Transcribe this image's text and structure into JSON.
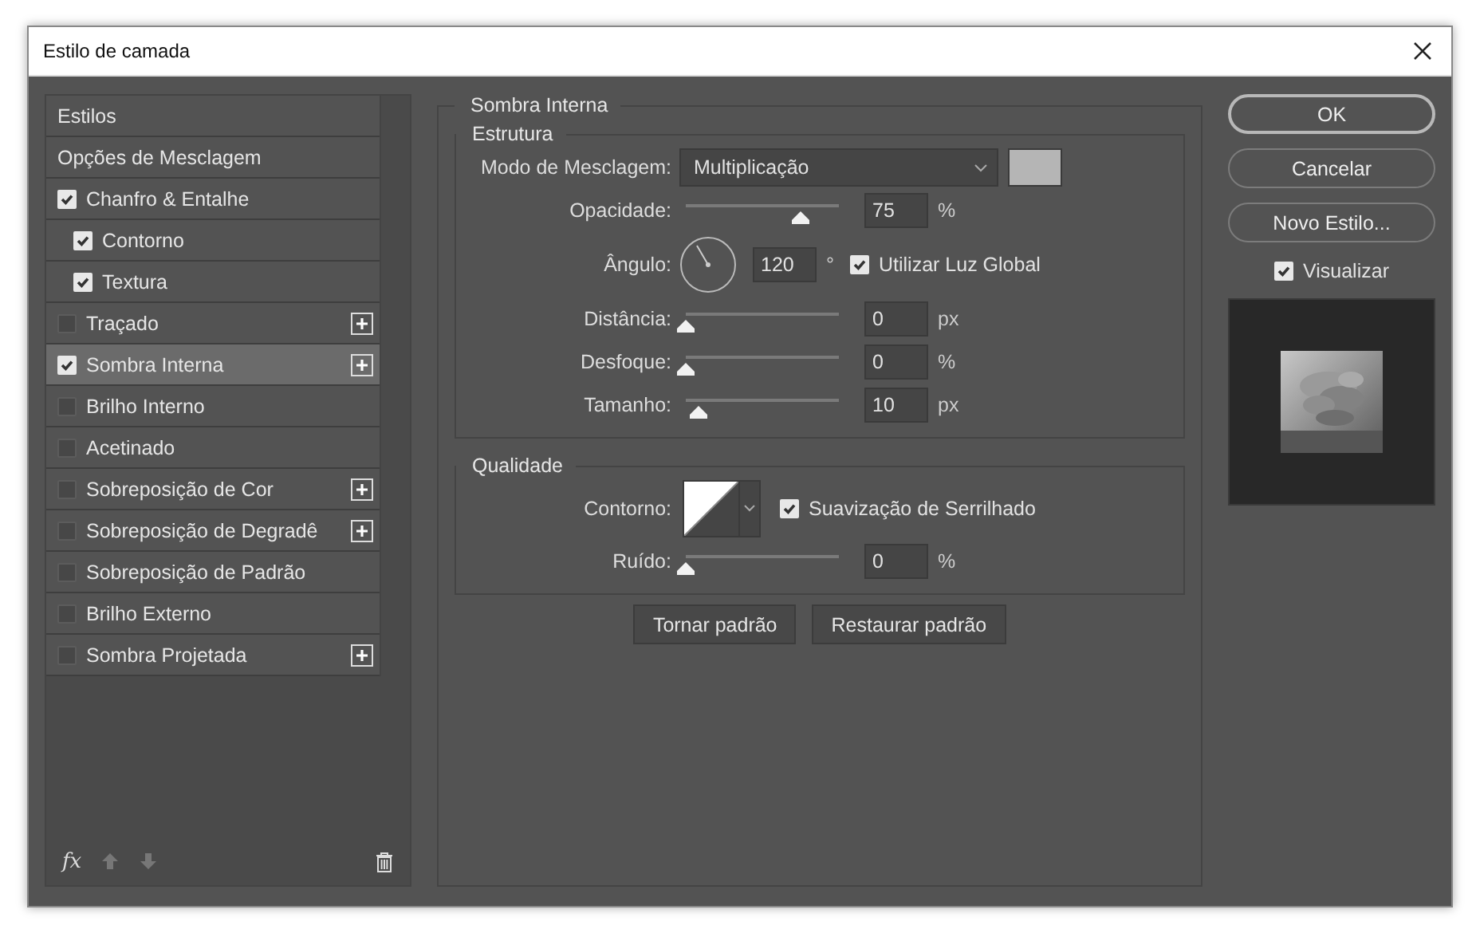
{
  "window": {
    "title": "Estilo de camada"
  },
  "styles": {
    "items": [
      {
        "label": "Estilos",
        "kind": "header",
        "selected": false
      },
      {
        "label": "Opções de Mesclagem",
        "kind": "header",
        "selected": false
      },
      {
        "label": "Chanfro & Entalhe",
        "kind": "check",
        "checked": true,
        "addable": false,
        "selected": false,
        "children": [
          {
            "label": "Contorno",
            "kind": "check",
            "checked": true,
            "addable": false,
            "selected": false
          },
          {
            "label": "Textura",
            "kind": "check",
            "checked": true,
            "addable": false,
            "selected": false
          }
        ]
      },
      {
        "label": "Traçado",
        "kind": "check",
        "checked": false,
        "addable": true,
        "selected": false
      },
      {
        "label": "Sombra Interna",
        "kind": "check",
        "checked": true,
        "addable": true,
        "selected": true
      },
      {
        "label": "Brilho Interno",
        "kind": "check",
        "checked": false,
        "addable": false,
        "selected": false
      },
      {
        "label": "Acetinado",
        "kind": "check",
        "checked": false,
        "addable": false,
        "selected": false
      },
      {
        "label": "Sobreposição de Cor",
        "kind": "check",
        "checked": false,
        "addable": true,
        "selected": false
      },
      {
        "label": "Sobreposição de Degradê",
        "kind": "check",
        "checked": false,
        "addable": true,
        "selected": false
      },
      {
        "label": "Sobreposição de Padrão",
        "kind": "check",
        "checked": false,
        "addable": false,
        "selected": false
      },
      {
        "label": "Brilho Externo",
        "kind": "check",
        "checked": false,
        "addable": false,
        "selected": false
      },
      {
        "label": "Sombra Projetada",
        "kind": "check",
        "checked": false,
        "addable": true,
        "selected": false
      }
    ],
    "footer": {
      "fx": "fx"
    }
  },
  "panel": {
    "title": "Sombra Interna",
    "structure": {
      "title": "Estrutura",
      "rows": [
        {
          "kind": "select",
          "label": "Modo de Mesclagem:",
          "value": "Multiplicação"
        },
        {
          "kind": "slider",
          "label": "Opacidade:",
          "level": 0.75,
          "value": "75",
          "unit": "%"
        },
        {
          "kind": "angle",
          "label": "Ângulo:",
          "value": "120",
          "unit": "°",
          "option": {
            "label": "Utilizar Luz Global",
            "checked": true
          }
        },
        {
          "kind": "slider",
          "label": "Distância:",
          "level": 0,
          "value": "0",
          "unit": "px"
        },
        {
          "kind": "slider",
          "label": "Desfoque:",
          "level": 0,
          "value": "0",
          "unit": "%"
        },
        {
          "kind": "slider",
          "label": "Tamanho:",
          "level": 0.08,
          "value": "10",
          "unit": "px"
        }
      ]
    },
    "quality": {
      "title": "Qualidade",
      "rows": [
        {
          "kind": "contour",
          "label": "Contorno:",
          "option": {
            "label": "Suavização de Serrilhado",
            "checked": true
          }
        },
        {
          "kind": "slider",
          "label": "Ruído:",
          "level": 0,
          "value": "0",
          "unit": "%"
        }
      ]
    },
    "buttons": [
      "Tornar padrão",
      "Restaurar padrão"
    ]
  },
  "actions": {
    "buttons": [
      {
        "label": "OK",
        "default": true
      },
      {
        "label": "Cancelar",
        "default": false
      },
      {
        "label": "Novo Estilo...",
        "default": false
      }
    ],
    "preview": {
      "label": "Visualizar",
      "checked": true
    }
  }
}
